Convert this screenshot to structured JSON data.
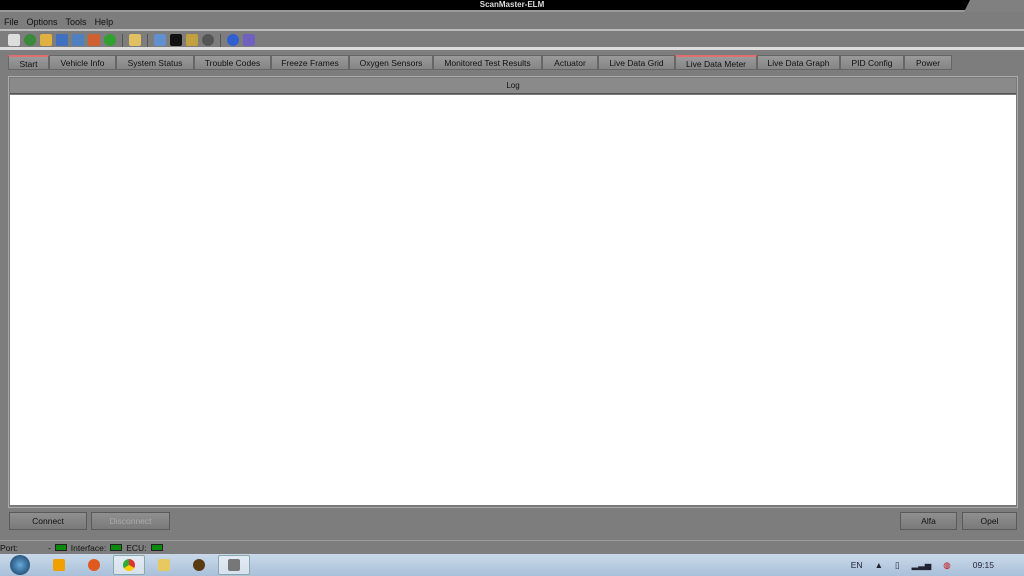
{
  "window": {
    "title": "ScanMaster-ELM"
  },
  "menu": [
    "File",
    "Options",
    "Tools",
    "Help"
  ],
  "toolbar_icons": [
    "connect-icon",
    "globe-icon",
    "vehicle-info-icon",
    "grid-icon",
    "meter-icon",
    "graph-icon",
    "money-icon",
    "clipboard-icon",
    "monitor-icon",
    "terminal-icon",
    "battery-icon",
    "settings-icon",
    "info-icon",
    "exit-icon"
  ],
  "tabs": [
    "Start",
    "Vehicle Info",
    "System Status",
    "Trouble Codes",
    "Freeze Frames",
    "Oxygen Sensors",
    "Monitored Test Results",
    "Actuator",
    "Live Data Grid",
    "Live Data Meter",
    "Live Data Graph",
    "PID Config",
    "Power"
  ],
  "log": {
    "header": "Log"
  },
  "buttons": {
    "connect": "Connect",
    "disconnect": "Disconnect",
    "alfa": "Alfa",
    "opel": "Opel"
  },
  "status": {
    "port_label": "Port:",
    "port_value": "-",
    "interface_label": "Interface:",
    "ecu_label": "ECU:",
    "led_color": "#0a8a0a"
  },
  "tray": {
    "lang": "EN",
    "time": "09:15"
  }
}
